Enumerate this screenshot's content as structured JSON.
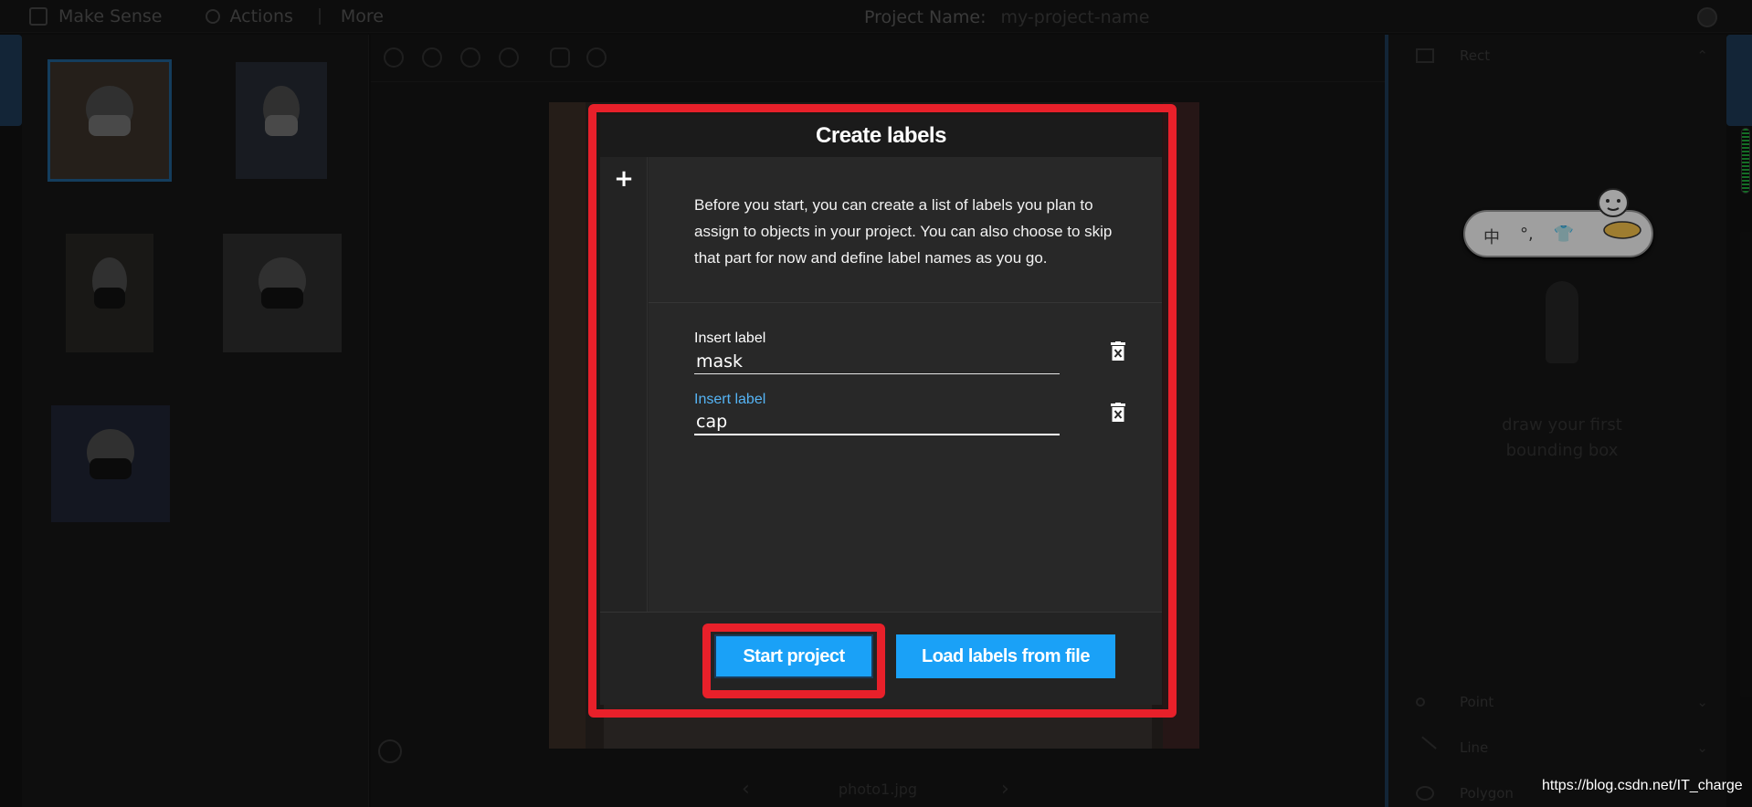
{
  "topbar": {
    "brand": "Make Sense",
    "actions": "Actions",
    "more": "More",
    "project_name_label": "Project Name:",
    "project_name_value": "my-project-name"
  },
  "editor": {
    "filename": "photo1.jpg"
  },
  "right_panel": {
    "rect_label": "Rect",
    "point_label": "Point",
    "line_label": "Line",
    "polygon_label": "Polygon",
    "hint": "draw your first bounding box"
  },
  "ime": {
    "chars": [
      "中",
      "°,",
      "👕"
    ]
  },
  "modal": {
    "title": "Create labels",
    "add_icon": "+",
    "intro": "Before you start, you can create a list of labels you plan to assign to objects in your project. You can also choose to skip that part for now and define label names as you go.",
    "labels": [
      {
        "caption": "Insert label",
        "value": "mask"
      },
      {
        "caption": "Insert label",
        "value": "cap"
      }
    ],
    "start_button": "Start project",
    "load_button": "Load labels from file"
  },
  "watermark": "https://blog.csdn.net/IT_charge",
  "colors": {
    "accent": "#1aa1f7",
    "highlight": "#e8202a",
    "active_label": "#55b4f5"
  }
}
